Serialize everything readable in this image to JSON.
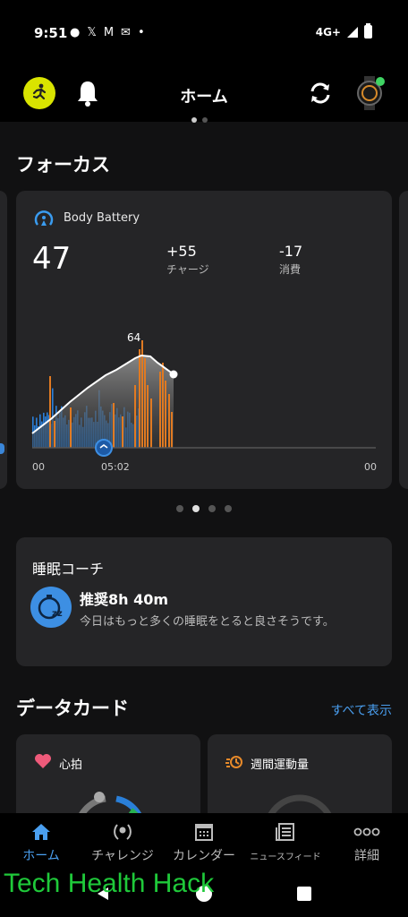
{
  "status_bar": {
    "time": "9:51",
    "network": "4G+"
  },
  "header": {
    "title": "ホーム"
  },
  "focus": {
    "title": "フォーカス"
  },
  "body_battery": {
    "title": "Body Battery",
    "value": "47",
    "charge_value": "+55",
    "charge_label": "チャージ",
    "drain_value": "-17",
    "drain_label": "消費",
    "peak_label": "64",
    "x_left": "00",
    "x_mid": "05:02",
    "x_right": "00"
  },
  "sleep_coach": {
    "title": "睡眠コーチ",
    "recommendation": "推奨8h 40m",
    "description": "今日はもっと多くの睡眠をとると良さそうです。"
  },
  "data_cards": {
    "title": "データカード",
    "show_all": "すべて表示",
    "heart_rate": "心拍",
    "weekly_intensity": "週間運動量"
  },
  "bottom_nav": {
    "home": "ホーム",
    "challenges": "チャレンジ",
    "calendar": "カレンダー",
    "newsfeed": "ニュースフィード",
    "more": "詳細"
  },
  "watermark": "Tech Health Hack",
  "colors": {
    "accent": "#4a9ff0",
    "sleep_bar": "#2a7fd8",
    "stress_bar": "#e07a22",
    "avatar": "#d9e400",
    "status_green": "#3fd463"
  }
}
